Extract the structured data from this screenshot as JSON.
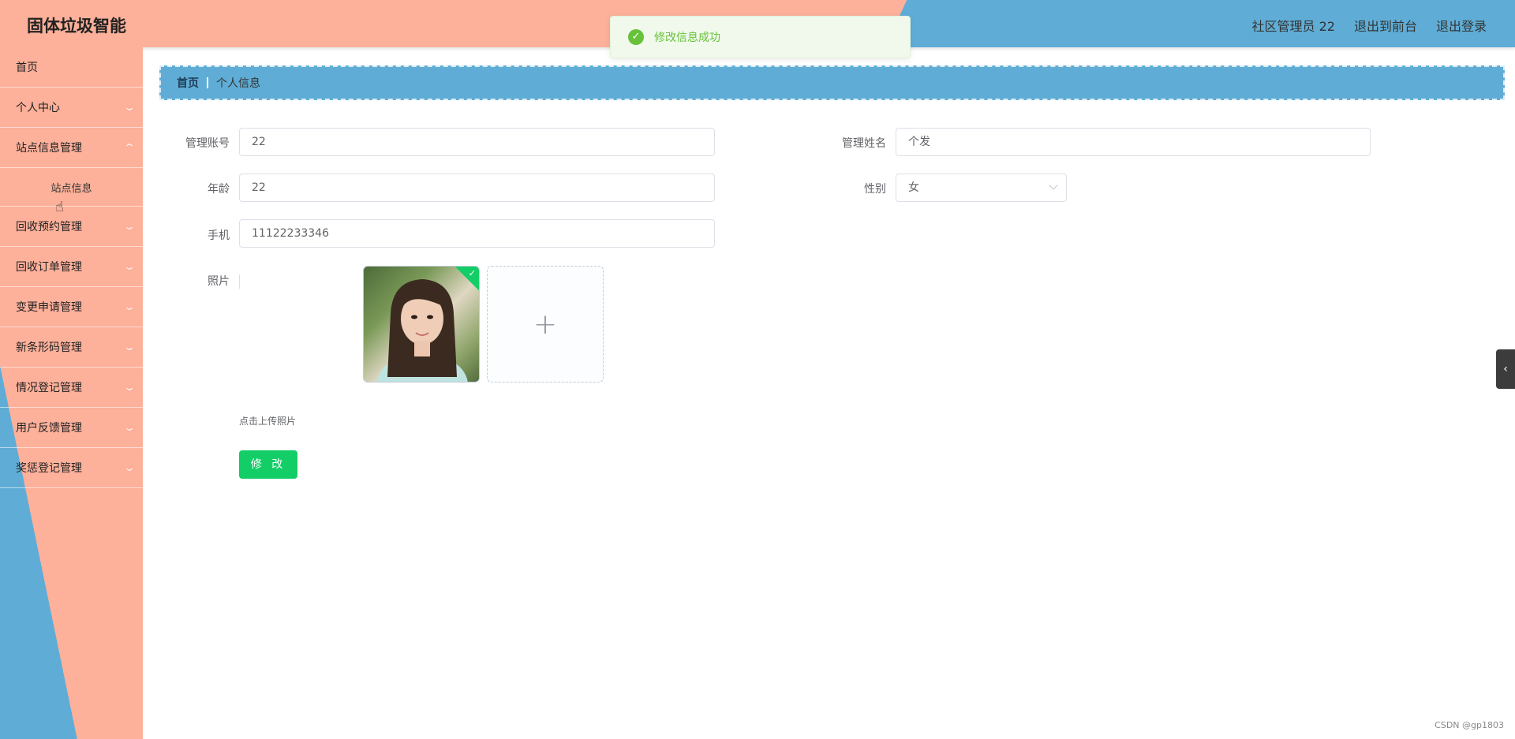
{
  "header": {
    "app_title": "固体垃圾智能",
    "user_label": "社区管理员 22",
    "back_to_front": "退出到前台",
    "logout": "退出登录"
  },
  "toast": {
    "message": "修改信息成功"
  },
  "sidebar": {
    "items": [
      {
        "label": "首页"
      },
      {
        "label": "个人中心"
      },
      {
        "label": "站点信息管理"
      },
      {
        "label": "站点信息"
      },
      {
        "label": "回收预约管理"
      },
      {
        "label": "回收订单管理"
      },
      {
        "label": "变更申请管理"
      },
      {
        "label": "新条形码管理"
      },
      {
        "label": "情况登记管理"
      },
      {
        "label": "用户反馈管理"
      },
      {
        "label": "奖惩登记管理"
      }
    ]
  },
  "breadcrumb": {
    "home": "首页",
    "current": "个人信息"
  },
  "form": {
    "account_label": "管理账号",
    "account_value": "22",
    "name_label": "管理姓名",
    "name_value": "个发",
    "age_label": "年龄",
    "age_value": "22",
    "gender_label": "性别",
    "gender_value": "女",
    "phone_label": "手机",
    "phone_value": "11122233346",
    "photo_label": "照片",
    "upload_tip": "点击上传照片",
    "submit_label": "修 改"
  },
  "watermark": "CSDN @gp1803",
  "icons": {
    "toast": "check-circle-icon",
    "upload": "plus-icon",
    "submenu": "chevron-down-icon",
    "side_toggle": "chevron-left-icon"
  },
  "colors": {
    "header_left": "#fdb09a",
    "header_right": "#5fadd6",
    "success": "#67c23a",
    "button": "#13ce66"
  }
}
